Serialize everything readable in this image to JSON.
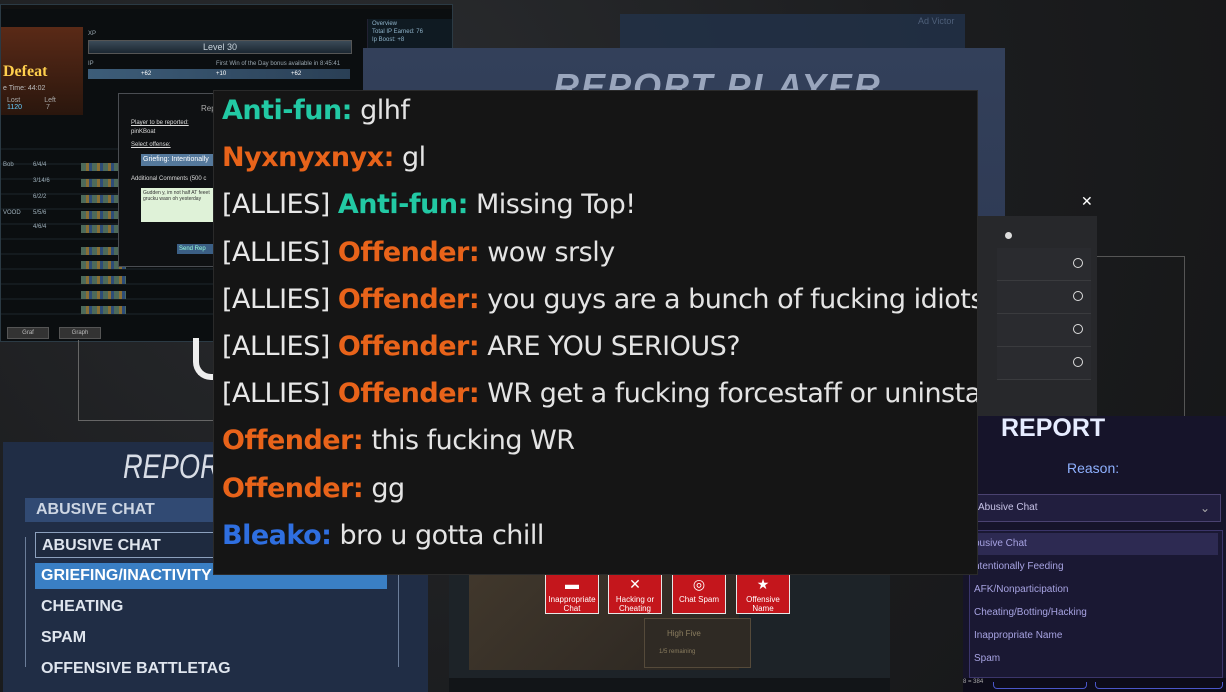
{
  "lol": {
    "defeat": "Defeat",
    "time": "e Time: 44:02",
    "level": "Level 30",
    "xp": "XP",
    "ip": "IP",
    "first_win": "First Win of the Day bonus available in 8:45:41",
    "plus1": "+62",
    "plus2": "+10",
    "plus3": "+62",
    "lost": "Lost",
    "left": "Left",
    "lost_val": "1120",
    "left_val": "7",
    "overview": [
      "Overview",
      "Total IP Earned: 76",
      "Ip Boost: +8"
    ],
    "rows": [
      "Bob",
      "",
      "",
      "VOOD",
      "",
      "",
      "",
      "",
      "",
      ""
    ],
    "kda": [
      "6/4/4",
      "3/14/6",
      "6/2/2",
      "5/5/6",
      "4/6/4",
      "",
      "",
      "",
      "",
      ""
    ],
    "buttons": [
      "Graf",
      "Graph"
    ]
  },
  "lol_report": {
    "title": "Rep",
    "player_label": "Player to be reported:",
    "player": "pinKBoat",
    "offense_label": "Select offense:",
    "offense": "Griefing: Intentionally",
    "comments_label": "Additional Comments (500 c",
    "comment_text": "Gudden y, im not half AT feeet grucku wasn oh yesterday",
    "send": "Send Rep"
  },
  "dota": {
    "title": "REPORT PLAYER"
  },
  "ghost": {
    "text": "Ad Victor"
  },
  "overwatch": {
    "title": "REPORT",
    "selected": "ABUSIVE CHAT",
    "options": [
      "ABUSIVE CHAT",
      "GRIEFING/INACTIVITY",
      "CHEATING",
      "SPAM",
      "OFFENSIVE BATTLETAG"
    ]
  },
  "heroes": {
    "title": "REPORT",
    "reason_label": "Reason:",
    "selected": "Abusive Chat",
    "options": [
      "busive Chat",
      "ntentionally Feeding",
      "AFK/Nonparticipation",
      "Cheating/Botting/Hacking",
      "Inappropriate Name",
      "Spam"
    ],
    "footer": "8 = 384"
  },
  "report_buttons": [
    {
      "label": "Inappropriate Chat",
      "icon": "chat-bubble-icon"
    },
    {
      "label": "Hacking or Cheating",
      "icon": "crossed-swords-icon"
    },
    {
      "label": "Chat Spam",
      "icon": "spiral-icon"
    },
    {
      "label": "Offensive Name",
      "icon": "star-icon"
    }
  ],
  "mid": {
    "high_five": "High Five",
    "remaining": "1/5 remaining"
  },
  "chat": [
    {
      "tag": "",
      "name": "Anti-fun:",
      "color": "#22c9a4",
      "text": "glhf"
    },
    {
      "tag": "",
      "name": "Nyxnyxnyx:",
      "color": "#e8631a",
      "text": "gl"
    },
    {
      "tag": "[ALLIES]",
      "name": "Anti-fun:",
      "color": "#22c9a4",
      "text": "Missing Top!"
    },
    {
      "tag": "[ALLIES]",
      "name": "Offender:",
      "color": "#e8631a",
      "text": "wow srsly"
    },
    {
      "tag": "[ALLIES]",
      "name": "Offender:",
      "color": "#e8631a",
      "text": "you guys are a bunch of fucking idiots"
    },
    {
      "tag": "[ALLIES]",
      "name": "Offender:",
      "color": "#e8631a",
      "text": "ARE YOU SERIOUS?"
    },
    {
      "tag": "[ALLIES]",
      "name": "Offender:",
      "color": "#e8631a",
      "text": "WR get a fucking forcestaff or uninstall"
    },
    {
      "tag": "",
      "name": "Offender:",
      "color": "#e8631a",
      "text": "this fucking WR"
    },
    {
      "tag": "",
      "name": "Offender:",
      "color": "#e8631a",
      "text": "gg"
    },
    {
      "tag": "",
      "name": "Bleako:",
      "color": "#2f6fe0",
      "text": "bro u gotta chill"
    }
  ]
}
